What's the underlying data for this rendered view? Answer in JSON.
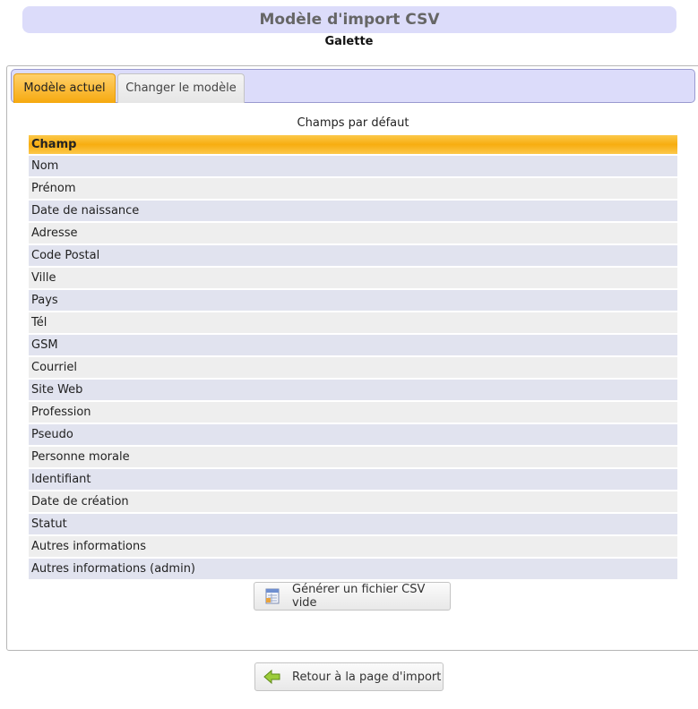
{
  "header": {
    "title": "Modèle d'import CSV",
    "subtitle": "Galette"
  },
  "tabs": [
    {
      "label": "Modèle actuel",
      "active": true
    },
    {
      "label": "Changer le modèle",
      "active": false
    }
  ],
  "fields_table": {
    "caption": "Champs par défaut",
    "column_header": "Champ",
    "rows": [
      "Nom",
      "Prénom",
      "Date de naissance",
      "Adresse",
      "Code Postal",
      "Ville",
      "Pays",
      "Tél",
      "GSM",
      "Courriel",
      "Site Web",
      "Profession",
      "Pseudo",
      "Personne morale",
      "Identifiant",
      "Date de création",
      "Statut",
      "Autres informations",
      "Autres informations (admin)"
    ]
  },
  "buttons": {
    "generate_csv": "Générer un fichier CSV vide",
    "generate_csv_icon": "csv-file-icon",
    "back": "Retour à la page d'import",
    "back_icon": "arrow-left-icon"
  },
  "colors": {
    "title_bar": "#dcdcfa",
    "accent_orange": "#f7ad10",
    "row_odd": "#e1e3ef",
    "row_even": "#eeeeee"
  }
}
